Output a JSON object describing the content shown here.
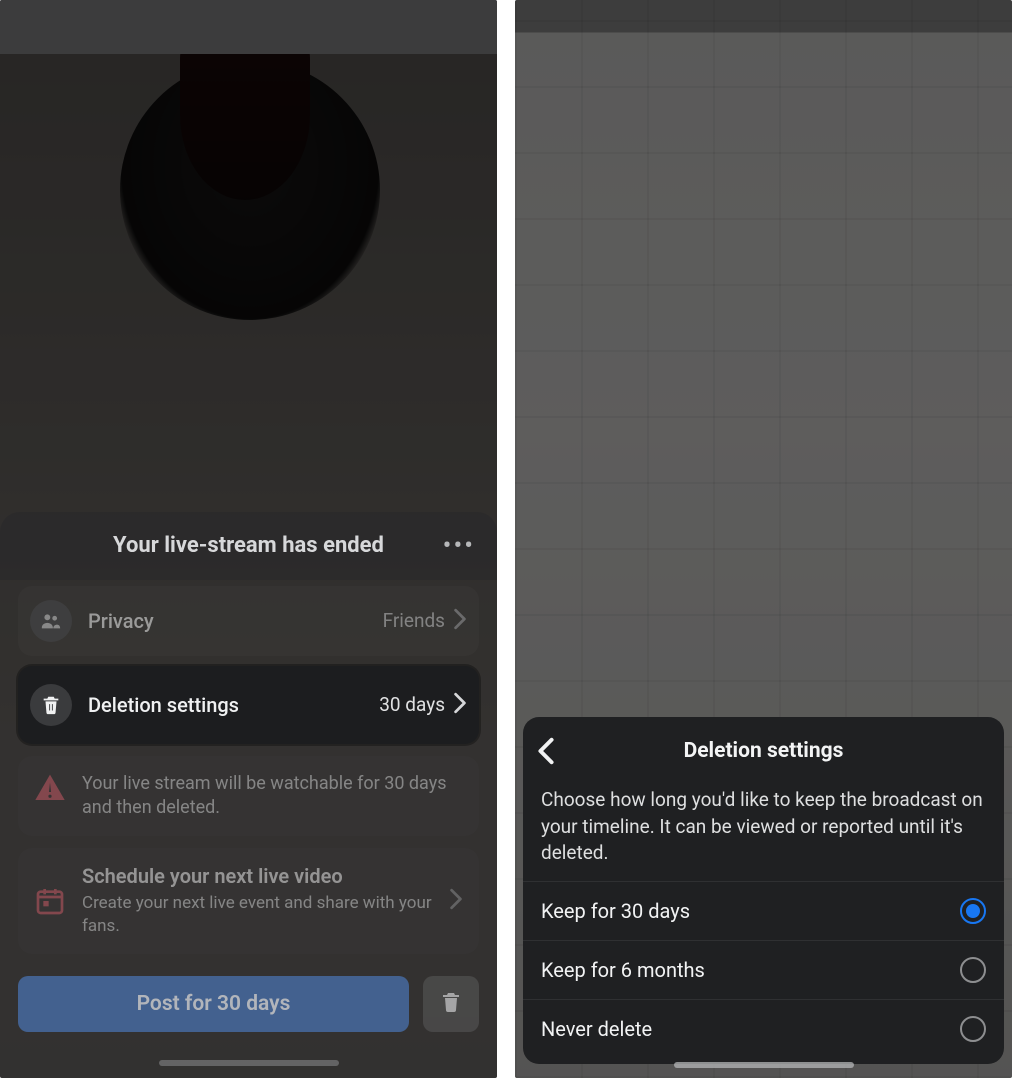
{
  "left": {
    "sheet_title": "Your live-stream has ended",
    "privacy": {
      "label": "Privacy",
      "value": "Friends"
    },
    "deletion": {
      "label": "Deletion settings",
      "value": "30 days"
    },
    "warning_text": "Your live stream will be watchable for 30 days and then deleted.",
    "schedule": {
      "title": "Schedule your next live video",
      "subtitle": "Create your next live event and share with your fans."
    },
    "post_button": "Post for 30 days"
  },
  "right": {
    "title": "Deletion settings",
    "description": "Choose how long you'd like to keep the broadcast on your timeline. It can be viewed or reported until it's deleted.",
    "options": [
      {
        "label": "Keep for 30 days",
        "selected": true
      },
      {
        "label": "Keep for 6 months",
        "selected": false
      },
      {
        "label": "Never delete",
        "selected": false
      }
    ]
  }
}
